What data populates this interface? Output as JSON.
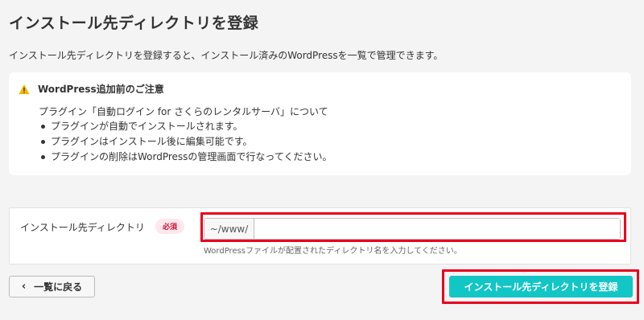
{
  "page": {
    "title": "インストール先ディレクトリを登録",
    "description": "インストール先ディレクトリを登録すると、インストール済みのWordPressを一覧で管理できます。"
  },
  "notice": {
    "icon": "warning-icon",
    "title": "WordPress追加前のご注意",
    "intro": "プラグイン「自動ログイン for さくらのレンタルサーバ」について",
    "items": [
      "プラグインが自動でインストールされます。",
      "プラグインはインストール後に編集可能です。",
      "プラグインの削除はWordPressの管理画面で行なってください。"
    ]
  },
  "form": {
    "field_label": "インストール先ディレクトリ",
    "required_badge": "必須",
    "prefix": "~/www/",
    "value": "",
    "placeholder": "",
    "helper_text": "WordPressファイルが配置されたディレクトリ名を入力してください。"
  },
  "actions": {
    "back_label": "一覧に戻る",
    "submit_label": "インストール先ディレクトリを登録"
  },
  "colors": {
    "accent": "#12c6c6",
    "highlight": "#e8001c",
    "required": "#d0103a",
    "warning": "#f5b800"
  }
}
